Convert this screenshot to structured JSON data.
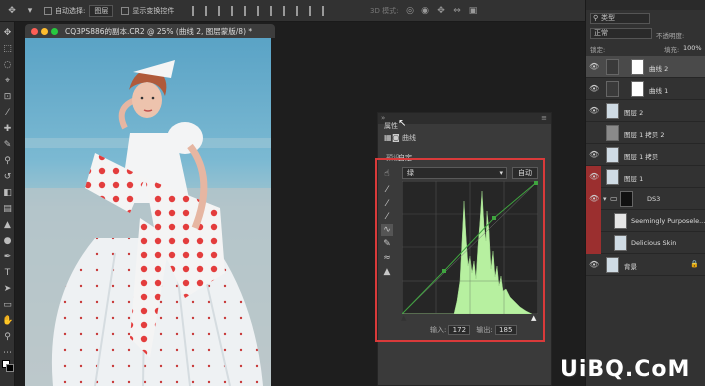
{
  "options_bar": {
    "auto_select_label": "自动选择:",
    "auto_select_target": "图层",
    "show_transform_label": "显示变换控件",
    "mode_3d_label": "3D 模式:"
  },
  "document": {
    "title": "CQ3PS886的副本.CR2 @ 25% (曲线 2, 图层蒙版/8) *"
  },
  "properties": {
    "panel_title": "属性",
    "adjustment_name": "曲线",
    "preset_label": "预设:",
    "preset_value": "自定",
    "channel": "绿",
    "auto_button": "自动",
    "input_label": "输入:",
    "input_value": "172",
    "output_label": "输出:",
    "output_value": "185",
    "curve_color": "#3fa53f",
    "histogram_color": "#b7f0a0"
  },
  "layers_panel": {
    "kind_label": "类型",
    "blend_mode": "正常",
    "opacity_label": "不透明度:",
    "lock_label": "锁定:",
    "fill_label": "填充:",
    "fill_value": "100%",
    "layers": [
      {
        "name": "曲线 2",
        "selected": true,
        "highlighted": false
      },
      {
        "name": "曲线 1",
        "selected": false,
        "highlighted": false
      },
      {
        "name": "图层 2",
        "selected": false,
        "highlighted": false
      },
      {
        "name": "图层 1 拷贝 2",
        "selected": false,
        "highlighted": false
      },
      {
        "name": "图层 1 拷贝",
        "selected": false,
        "highlighted": false
      },
      {
        "name": "图层 1",
        "selected": false,
        "highlighted": true
      },
      {
        "name": "DS3",
        "selected": false,
        "highlighted": true
      },
      {
        "name": "Seemingly Purposele...",
        "selected": false,
        "highlighted": true
      },
      {
        "name": "Delicious Skin",
        "selected": false,
        "highlighted": true
      },
      {
        "name": "背景",
        "selected": false,
        "highlighted": false
      }
    ]
  },
  "watermark": "UiBQ.CoM",
  "colors": {
    "highlight_box": "#d93a3a",
    "layer_highlight": "#9b2f2f"
  }
}
